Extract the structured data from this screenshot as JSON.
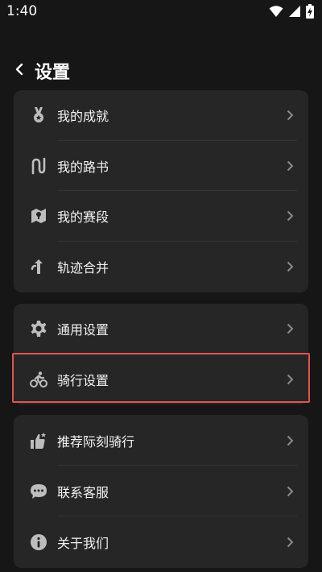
{
  "status_bar": {
    "time": "1:40"
  },
  "header": {
    "title": "设置"
  },
  "groups": [
    {
      "items": [
        {
          "label": "我的成就",
          "icon": "medal-icon"
        },
        {
          "label": "我的路书",
          "icon": "route-icon"
        },
        {
          "label": "我的赛段",
          "icon": "map-pin-icon"
        },
        {
          "label": "轨迹合并",
          "icon": "merge-icon"
        }
      ]
    },
    {
      "items": [
        {
          "label": "通用设置",
          "icon": "gear-icon"
        },
        {
          "label": "骑行设置",
          "icon": "cyclist-icon",
          "highlighted": true
        }
      ]
    },
    {
      "items": [
        {
          "label": "推荐际刻骑行",
          "icon": "thumbs-up-icon"
        },
        {
          "label": "联系客服",
          "icon": "chat-icon"
        },
        {
          "label": "关于我们",
          "icon": "info-icon"
        }
      ]
    }
  ],
  "colors": {
    "background": "#161616",
    "card": "#262626",
    "highlight": "#e25353"
  }
}
